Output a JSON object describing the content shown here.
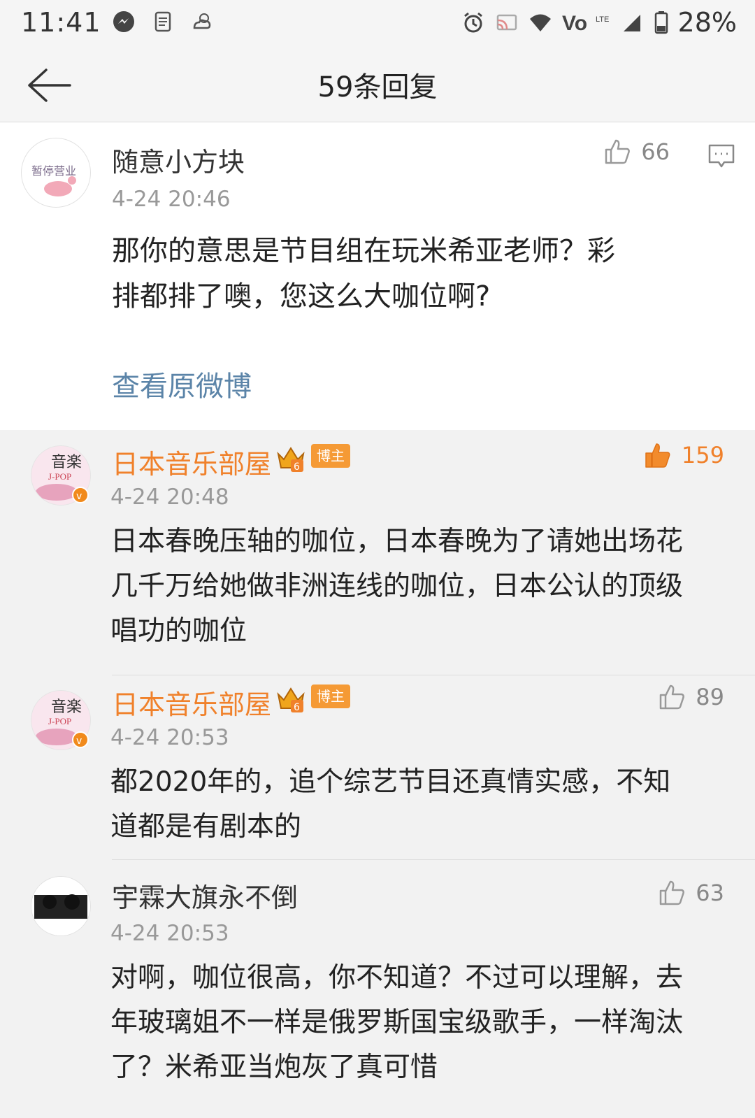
{
  "status": {
    "time": "11:41",
    "battery": "28%",
    "icons_left": [
      "messenger-icon",
      "document-icon",
      "weather-icon"
    ],
    "icons_right": [
      "alarm-icon",
      "cast-icon",
      "wifi-icon",
      "volte-icon",
      "signal-icon",
      "battery-icon"
    ]
  },
  "header": {
    "title": "59条回复"
  },
  "main_comment": {
    "user": "随意小方块",
    "time": "4-24 20:46",
    "likes": "66",
    "line1": "那你的意思是节目组在玩米希亚老师？彩",
    "line2": "排都排了噢，您这么大咖位啊?",
    "view_original": "查看原微博"
  },
  "replies": [
    {
      "user": "日本音乐部屋",
      "badge": "博主",
      "time": "4-24 20:48",
      "likes": "159",
      "liked": true,
      "lines": [
        "日本春晚压轴的咖位，日本春晚为了请她出场花",
        "几千万给她做非洲连线的咖位，日本公认的顶级",
        "唱功的咖位"
      ]
    },
    {
      "user": "日本音乐部屋",
      "badge": "博主",
      "time": "4-24 20:53",
      "likes": "89",
      "liked": false,
      "lines": [
        "都2020年的，追个综艺节目还真情实感，不知",
        "道都是有剧本的"
      ]
    },
    {
      "user": "宇霖大旗永不倒",
      "time": "4-24 20:53",
      "likes": "63",
      "liked": false,
      "lines": [
        "对啊，咖位很高，你不知道？不过可以理解，去",
        "年玻璃姐不一样是俄罗斯国宝级歌手，一样淘汰",
        "了？米希亚当炮灰了真可惜"
      ]
    }
  ],
  "colors": {
    "orange_name": "#f0812b",
    "link_blue": "#5b84a8",
    "badge_orange": "#f59a35"
  }
}
